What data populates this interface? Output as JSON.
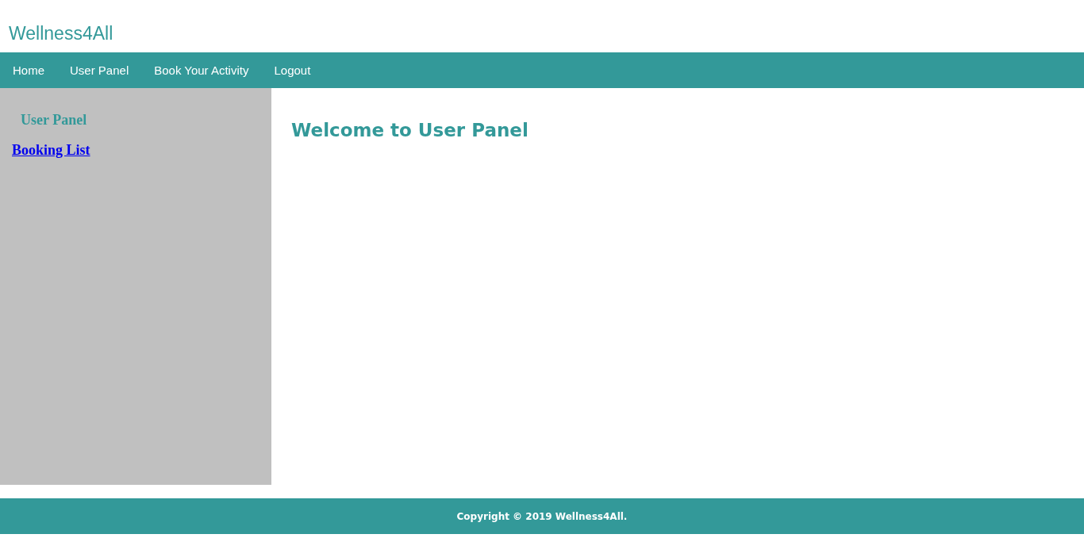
{
  "header": {
    "logo": "Wellness4All"
  },
  "nav": {
    "items": [
      {
        "label": "Home"
      },
      {
        "label": "User Panel"
      },
      {
        "label": "Book Your Activity"
      },
      {
        "label": "Logout"
      }
    ]
  },
  "sidebar": {
    "title": "User Panel",
    "links": [
      {
        "label": "Booking List"
      }
    ]
  },
  "main": {
    "heading": "Welcome to User Panel"
  },
  "footer": {
    "copyright": "Copyright © 2019 Wellness4All."
  }
}
